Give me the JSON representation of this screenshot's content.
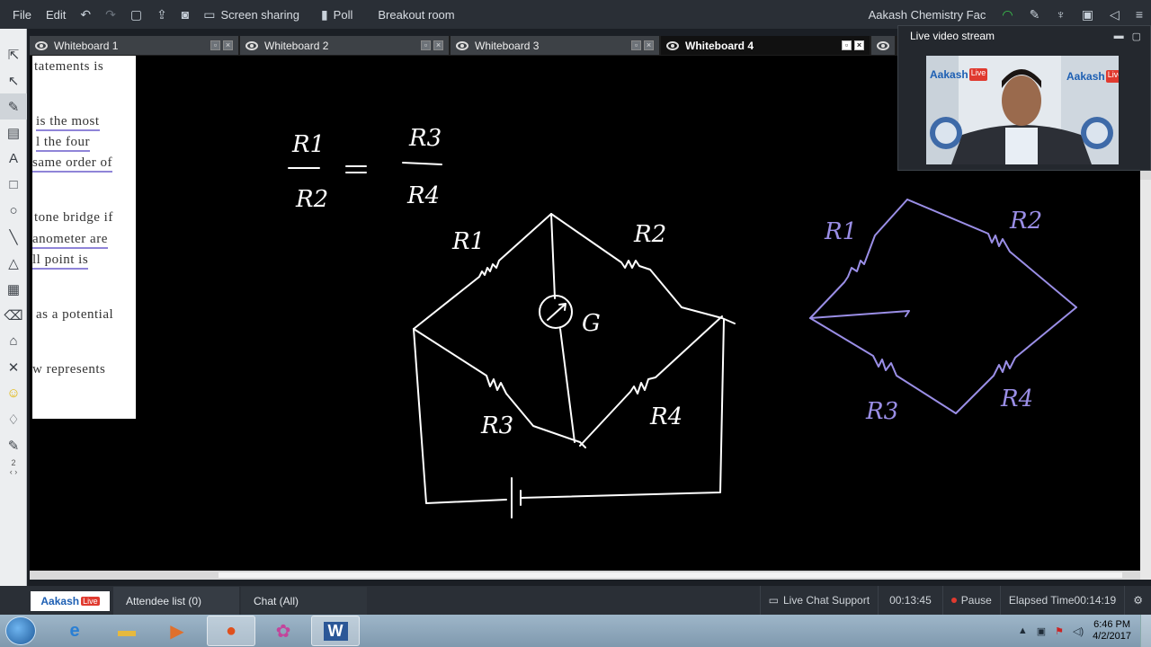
{
  "menu": {
    "file": "File",
    "edit": "Edit",
    "screen_sharing": "Screen sharing",
    "poll": "Poll",
    "breakout_room": "Breakout room",
    "user_name": "Aakash Chemistry Fac"
  },
  "tabs": [
    {
      "label": "Whiteboard 1",
      "active": false
    },
    {
      "label": "Whiteboard 2",
      "active": false
    },
    {
      "label": "Whiteboard 3",
      "active": false
    },
    {
      "label": "Whiteboard 4",
      "active": true
    }
  ],
  "video": {
    "title": "Live video stream",
    "logo_text": "Aakash",
    "logo_badge": "Live"
  },
  "scan_lines": [
    "tatements is",
    "is  the  most",
    "l   the   four",
    "same order of",
    "tone bridge if",
    "anometer are",
    "ll   point   is",
    "as a potential",
    "w  represents"
  ],
  "board_labels": {
    "eq_r1": "R1",
    "eq_r2": "R2",
    "eq_r3": "R3",
    "eq_r4": "R4",
    "equals": "=",
    "r1": "R1",
    "r2": "R2",
    "r3": "R3",
    "r4": "R4",
    "g": "G",
    "p_r1": "R1",
    "p_r2": "R2",
    "p_r3": "R3",
    "p_r4": "R4"
  },
  "page_indicator": "2",
  "status": {
    "brand_text": "Aakash",
    "brand_badge": "Live",
    "attendee_list": "Attendee list (0)",
    "chat": "Chat (All)",
    "live_chat_support": "Live Chat Support",
    "timer": "00:13:45",
    "pause": "Pause",
    "elapsed_label": "Elapsed Time",
    "elapsed_value": "00:14:19"
  },
  "taskbar": {
    "time": "6:46 PM",
    "date": "4/2/2017",
    "word_label": "W"
  },
  "colors": {
    "ink_white": "#ffffff",
    "ink_purple": "#9a8ee6",
    "menubar": "#2a2f36",
    "accent_green": "#3ccf4e"
  }
}
